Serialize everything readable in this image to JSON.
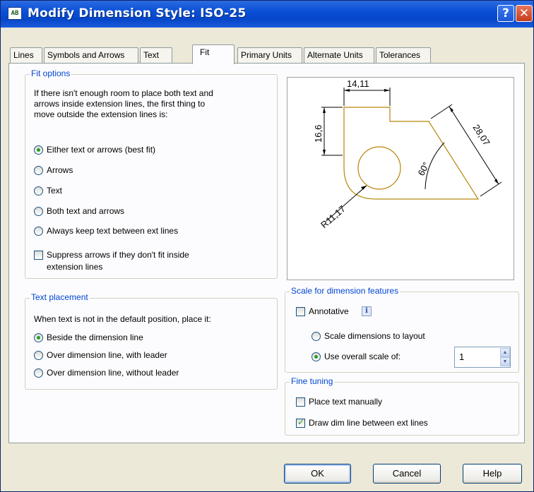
{
  "window": {
    "title": "Modify Dimension Style: ISO-25",
    "app_icon_text": "AB",
    "help_glyph": "?",
    "close_glyph": "✕"
  },
  "tabs": [
    {
      "label": "Lines",
      "active": false
    },
    {
      "label": "Symbols and Arrows",
      "active": false
    },
    {
      "label": "Text",
      "active": false
    },
    {
      "label": "Fit",
      "active": true
    },
    {
      "label": "Primary Units",
      "active": false
    },
    {
      "label": "Alternate Units",
      "active": false
    },
    {
      "label": "Tolerances",
      "active": false
    }
  ],
  "fit_options": {
    "legend": "Fit options",
    "description": [
      "If there isn't enough room to place both text and",
      "arrows inside extension lines, the first thing to",
      "move outside the extension lines is:"
    ],
    "options": [
      {
        "label": "Either text or arrows (best fit)",
        "selected": true
      },
      {
        "label": "Arrows",
        "selected": false
      },
      {
        "label": "Text",
        "selected": false
      },
      {
        "label": "Both text and arrows",
        "selected": false
      },
      {
        "label": "Always keep text between ext lines",
        "selected": false
      }
    ],
    "suppress": {
      "label_line1": "Suppress arrows if they don't fit inside",
      "label_line2": "extension lines",
      "checked": false
    }
  },
  "text_placement": {
    "legend": "Text placement",
    "description": "When text is not in the default position, place it:",
    "options": [
      {
        "label": "Beside the dimension line",
        "selected": true
      },
      {
        "label": "Over dimension line, with leader",
        "selected": false
      },
      {
        "label": "Over dimension line, without leader",
        "selected": false
      }
    ]
  },
  "preview": {
    "dims": {
      "top": "14,11",
      "left": "16,6",
      "right": "28,07",
      "angle": "60°",
      "radius": "R11,17"
    },
    "geometry_color": "#b8860b"
  },
  "scale": {
    "legend": "Scale for dimension features",
    "annotative_label": "Annotative",
    "annotative_checked": false,
    "info_icon": "i",
    "layout_label": "Scale dimensions to layout",
    "layout_selected": false,
    "overall_label": "Use overall scale of:",
    "overall_selected": true,
    "overall_value": "1"
  },
  "fine_tuning": {
    "legend": "Fine tuning",
    "manual_label": "Place text manually",
    "manual_checked": false,
    "dimline_label": "Draw dim line between ext lines",
    "dimline_checked": true
  },
  "buttons": {
    "ok": "OK",
    "cancel": "Cancel",
    "help": "Help"
  },
  "colors": {
    "title_bar": "#0a4fd6",
    "group_legend": "#0046d5",
    "check_radio_mark": "#21a121"
  }
}
